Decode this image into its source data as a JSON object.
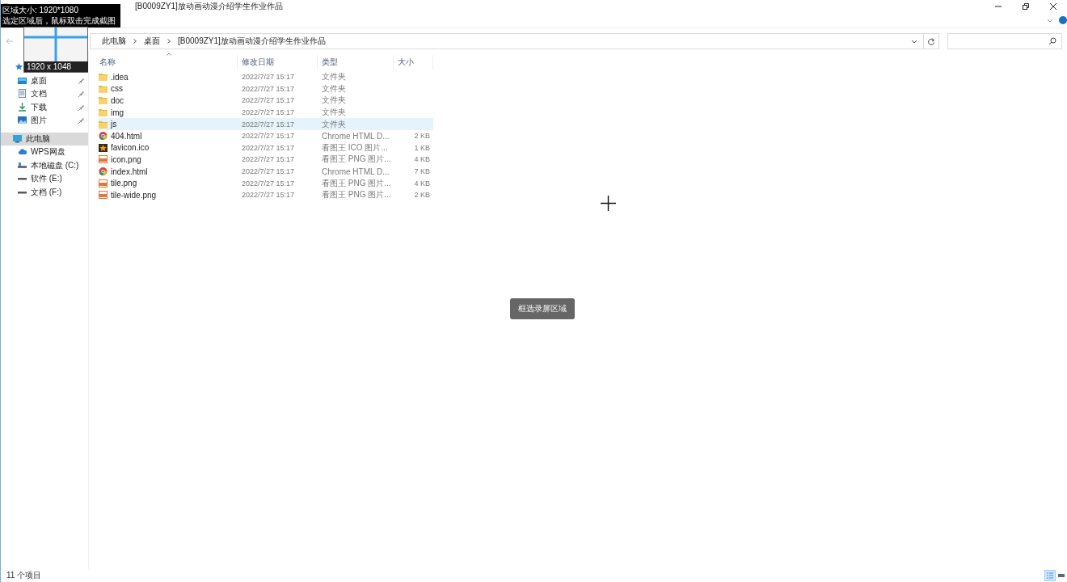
{
  "window": {
    "title": "[B0009ZY1]放动画动漫介绍学生作业作品"
  },
  "capture_overlay": {
    "size_label": "区域大小: 1920*1080",
    "hint": "选定区域后，鼠标双击完成截图",
    "magnifier_label": "1920 x 1048",
    "toast": "框选录屏区域"
  },
  "address_bar": {
    "crumbs": [
      "此电脑",
      "桌面",
      "[B0009ZY1]放动画动漫介绍学生作业作品"
    ]
  },
  "sidebar": {
    "items": [
      {
        "kind": "quick",
        "pinned": false,
        "selected": false
      },
      {
        "kind": "desktop",
        "label": "桌面",
        "pinned": true,
        "selected": false
      },
      {
        "kind": "docs",
        "label": "文档",
        "pinned": true,
        "selected": false
      },
      {
        "kind": "download",
        "label": "下载",
        "pinned": true,
        "selected": false
      },
      {
        "kind": "pictures",
        "label": "图片",
        "pinned": true,
        "selected": false
      },
      {
        "kind": "pc",
        "label": "此电脑",
        "pinned": false,
        "selected": true
      },
      {
        "kind": "cloud",
        "label": "WPS网盘",
        "pinned": false,
        "selected": false
      },
      {
        "kind": "disk",
        "label": "本地磁盘 (C:)",
        "pinned": false,
        "selected": false
      },
      {
        "kind": "drive",
        "label": "软件 (E:)",
        "pinned": false,
        "selected": false
      },
      {
        "kind": "drive",
        "label": "文档 (F:)",
        "pinned": false,
        "selected": false
      }
    ]
  },
  "table": {
    "columns": [
      "名称",
      "修改日期",
      "类型",
      "大小"
    ],
    "rows": [
      {
        "kind": "folder",
        "name": ".idea",
        "date": "2022/7/27 15:17",
        "type": "文件夹",
        "selected": false
      },
      {
        "kind": "folder",
        "name": "css",
        "date": "2022/7/27 15:17",
        "type": "文件夹",
        "selected": false
      },
      {
        "kind": "folder",
        "name": "doc",
        "date": "2022/7/27 15:17",
        "type": "文件夹",
        "selected": false
      },
      {
        "kind": "folder",
        "name": "img",
        "date": "2022/7/27 15:17",
        "type": "文件夹",
        "selected": false
      },
      {
        "kind": "folder",
        "name": "js",
        "date": "2022/7/27 15:17",
        "type": "文件夹",
        "selected": true
      },
      {
        "kind": "chrome",
        "name": "404.html",
        "date": "2022/7/27 15:17",
        "type": "Chrome HTML D...",
        "size": "2 KB",
        "selected": false
      },
      {
        "kind": "star",
        "name": "favicon.ico",
        "date": "2022/7/27 15:17",
        "type": "看图王 ICO 图片...",
        "size": "1 KB",
        "selected": false
      },
      {
        "kind": "png",
        "name": "icon.png",
        "date": "2022/7/27 15:17",
        "type": "看图王 PNG 图片...",
        "size": "4 KB",
        "selected": false
      },
      {
        "kind": "chrome",
        "name": "index.html",
        "date": "2022/7/27 15:17",
        "type": "Chrome HTML D...",
        "size": "7 KB",
        "selected": false
      },
      {
        "kind": "png",
        "name": "tile.png",
        "date": "2022/7/27 15:17",
        "type": "看图王 PNG 图片...",
        "size": "4 KB",
        "selected": false
      },
      {
        "kind": "png",
        "name": "tile-wide.png",
        "date": "2022/7/27 15:17",
        "type": "看图王 PNG 图片...",
        "size": "2 KB",
        "selected": false
      }
    ]
  },
  "status_bar": {
    "count": "11 个项目"
  }
}
